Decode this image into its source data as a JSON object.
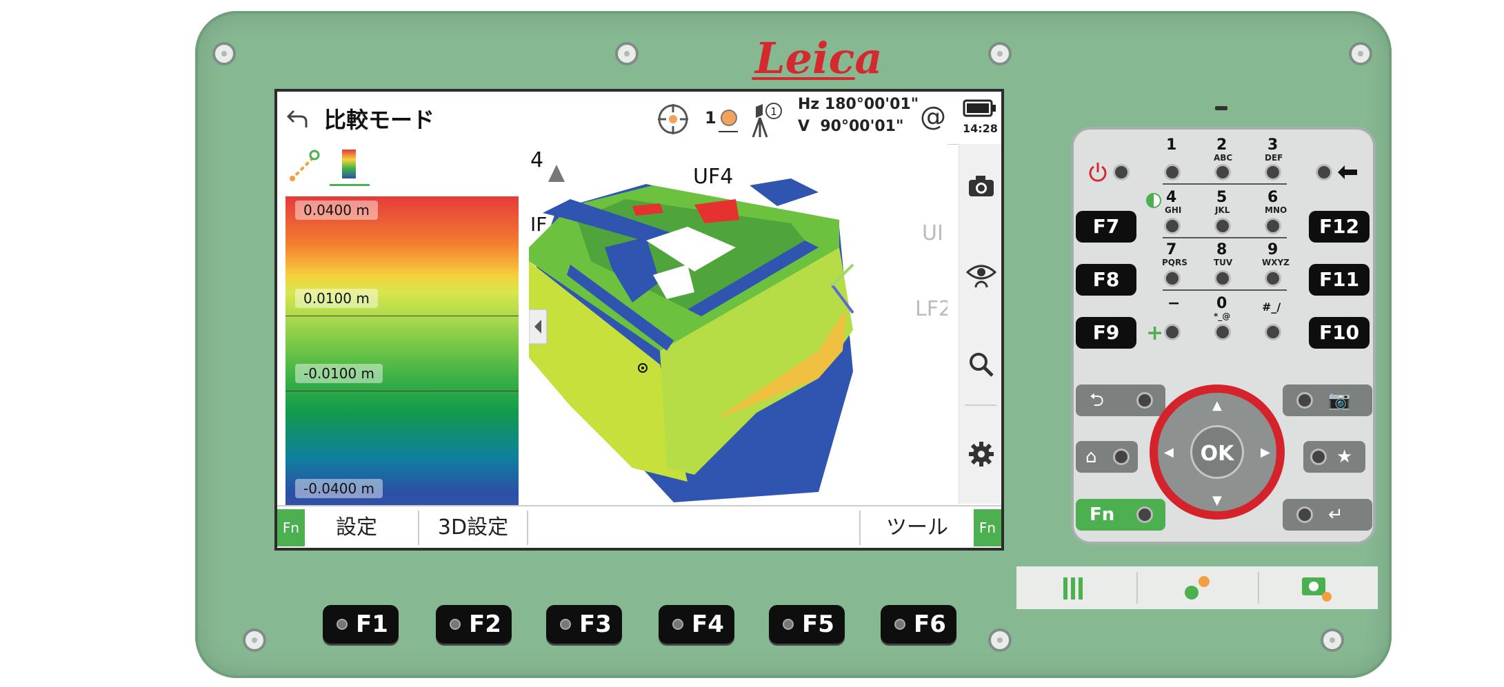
{
  "device": {
    "brand": "Leica",
    "colors": {
      "body": "#86b892",
      "accent_red": "#d42a2f",
      "fn_green": "#4caf50"
    }
  },
  "screen": {
    "title": "比較モード",
    "back_icon": "back-arrow-icon",
    "status": {
      "target_count": "1",
      "hz_label": "Hz",
      "hz_value": "180°00'01\"",
      "v_label": "V",
      "v_value": "90°00'01\"",
      "at_symbol": "@",
      "time": "14:28"
    },
    "legend": {
      "labels": [
        "0.0400 m",
        "0.0100 m",
        "-0.0100 m",
        "-0.0400 m"
      ]
    },
    "view3d": {
      "labels": [
        "4",
        "UF4",
        "IF",
        "UI",
        "LF2"
      ]
    },
    "softkeys": {
      "fn_left": "Fn",
      "settings": "設定",
      "settings_3d": "3D設定",
      "tools": "ツール",
      "fn_right": "Fn"
    }
  },
  "fkeys_bottom": [
    "F1",
    "F2",
    "F3",
    "F4",
    "F5",
    "F6"
  ],
  "keypad": {
    "left_fkeys": [
      "F7",
      "F8",
      "F9"
    ],
    "right_fkeys": [
      "F12",
      "F11",
      "F10"
    ],
    "numbers": [
      {
        "n": "1",
        "s": ""
      },
      {
        "n": "2",
        "s": "ABC"
      },
      {
        "n": "3",
        "s": "DEF"
      },
      {
        "n": "4",
        "s": "GHI"
      },
      {
        "n": "5",
        "s": "JKL"
      },
      {
        "n": "6",
        "s": "MNO"
      },
      {
        "n": "7",
        "s": "PQRS"
      },
      {
        "n": "8",
        "s": "TUV"
      },
      {
        "n": "9",
        "s": "WXYZ"
      },
      {
        "n": "−",
        "s": ""
      },
      {
        "n": "0",
        "s": "*_@"
      },
      {
        "n": "#_/",
        "s": ""
      }
    ],
    "fn_label": "Fn",
    "ok_label": "OK"
  }
}
